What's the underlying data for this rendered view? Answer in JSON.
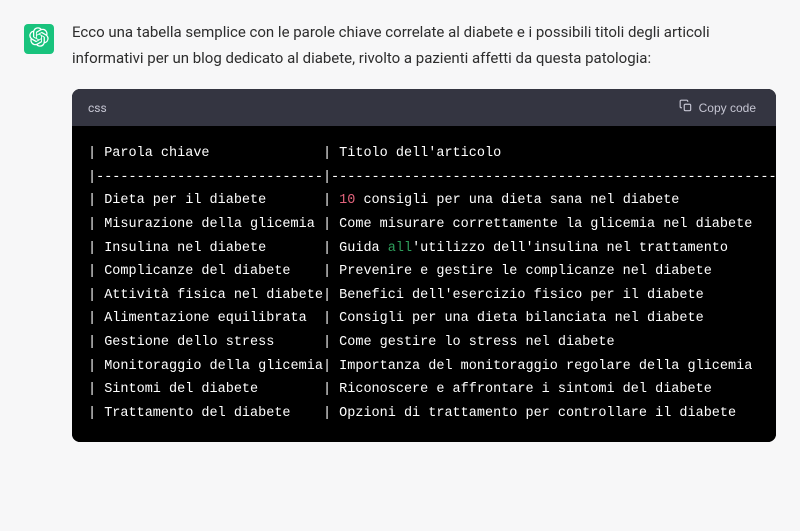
{
  "intro": "Ecco una tabella semplice con le parole chiave correlate al diabete e i possibili titoli degli articoli informativi per un blog dedicato al diabete, rivolto a pazienti affetti da questa patologia:",
  "code": {
    "language": "css",
    "copy_label": "Copy code",
    "header_col1": "Parola chiave",
    "header_col2": "Titolo dell'articolo",
    "rows": [
      {
        "c1": "Dieta per il diabete",
        "c2_pre": "",
        "c2_tok": "10",
        "tok_class": "tok-num",
        "c2_post": " consigli per una dieta sana nel diabete"
      },
      {
        "c1": "Misurazione della glicemia",
        "c2_pre": "Come misurare correttamente la glicemia nel diabete",
        "c2_tok": "",
        "tok_class": "",
        "c2_post": ""
      },
      {
        "c1": "Insulina nel diabete",
        "c2_pre": "Guida ",
        "c2_tok": "all",
        "tok_class": "tok-kw",
        "c2_post": "'utilizzo dell'insulina nel trattamento"
      },
      {
        "c1": "Complicanze del diabete",
        "c2_pre": "Prevenire e gestire le complicanze nel diabete",
        "c2_tok": "",
        "tok_class": "",
        "c2_post": ""
      },
      {
        "c1": "Attività fisica nel diabete",
        "c2_pre": "Benefici dell'esercizio fisico per il diabete",
        "c2_tok": "",
        "tok_class": "",
        "c2_post": ""
      },
      {
        "c1": "Alimentazione equilibrata",
        "c2_pre": "Consigli per una dieta bilanciata nel diabete",
        "c2_tok": "",
        "tok_class": "",
        "c2_post": ""
      },
      {
        "c1": "Gestione dello stress",
        "c2_pre": "Come gestire lo stress nel diabete",
        "c2_tok": "",
        "tok_class": "",
        "c2_post": ""
      },
      {
        "c1": "Monitoraggio della glicemia",
        "c2_pre": "Importanza del monitoraggio regolare della glicemia",
        "c2_tok": "",
        "tok_class": "",
        "c2_post": ""
      },
      {
        "c1": "Sintomi del diabete",
        "c2_pre": "Riconoscere e affrontare i sintomi del diabete",
        "c2_tok": "",
        "tok_class": "",
        "c2_post": ""
      },
      {
        "c1": "Trattamento del diabete",
        "c2_pre": "Opzioni di trattamento per controllare il diabete",
        "c2_tok": "",
        "tok_class": "",
        "c2_post": ""
      }
    ]
  },
  "col1_width": 27
}
